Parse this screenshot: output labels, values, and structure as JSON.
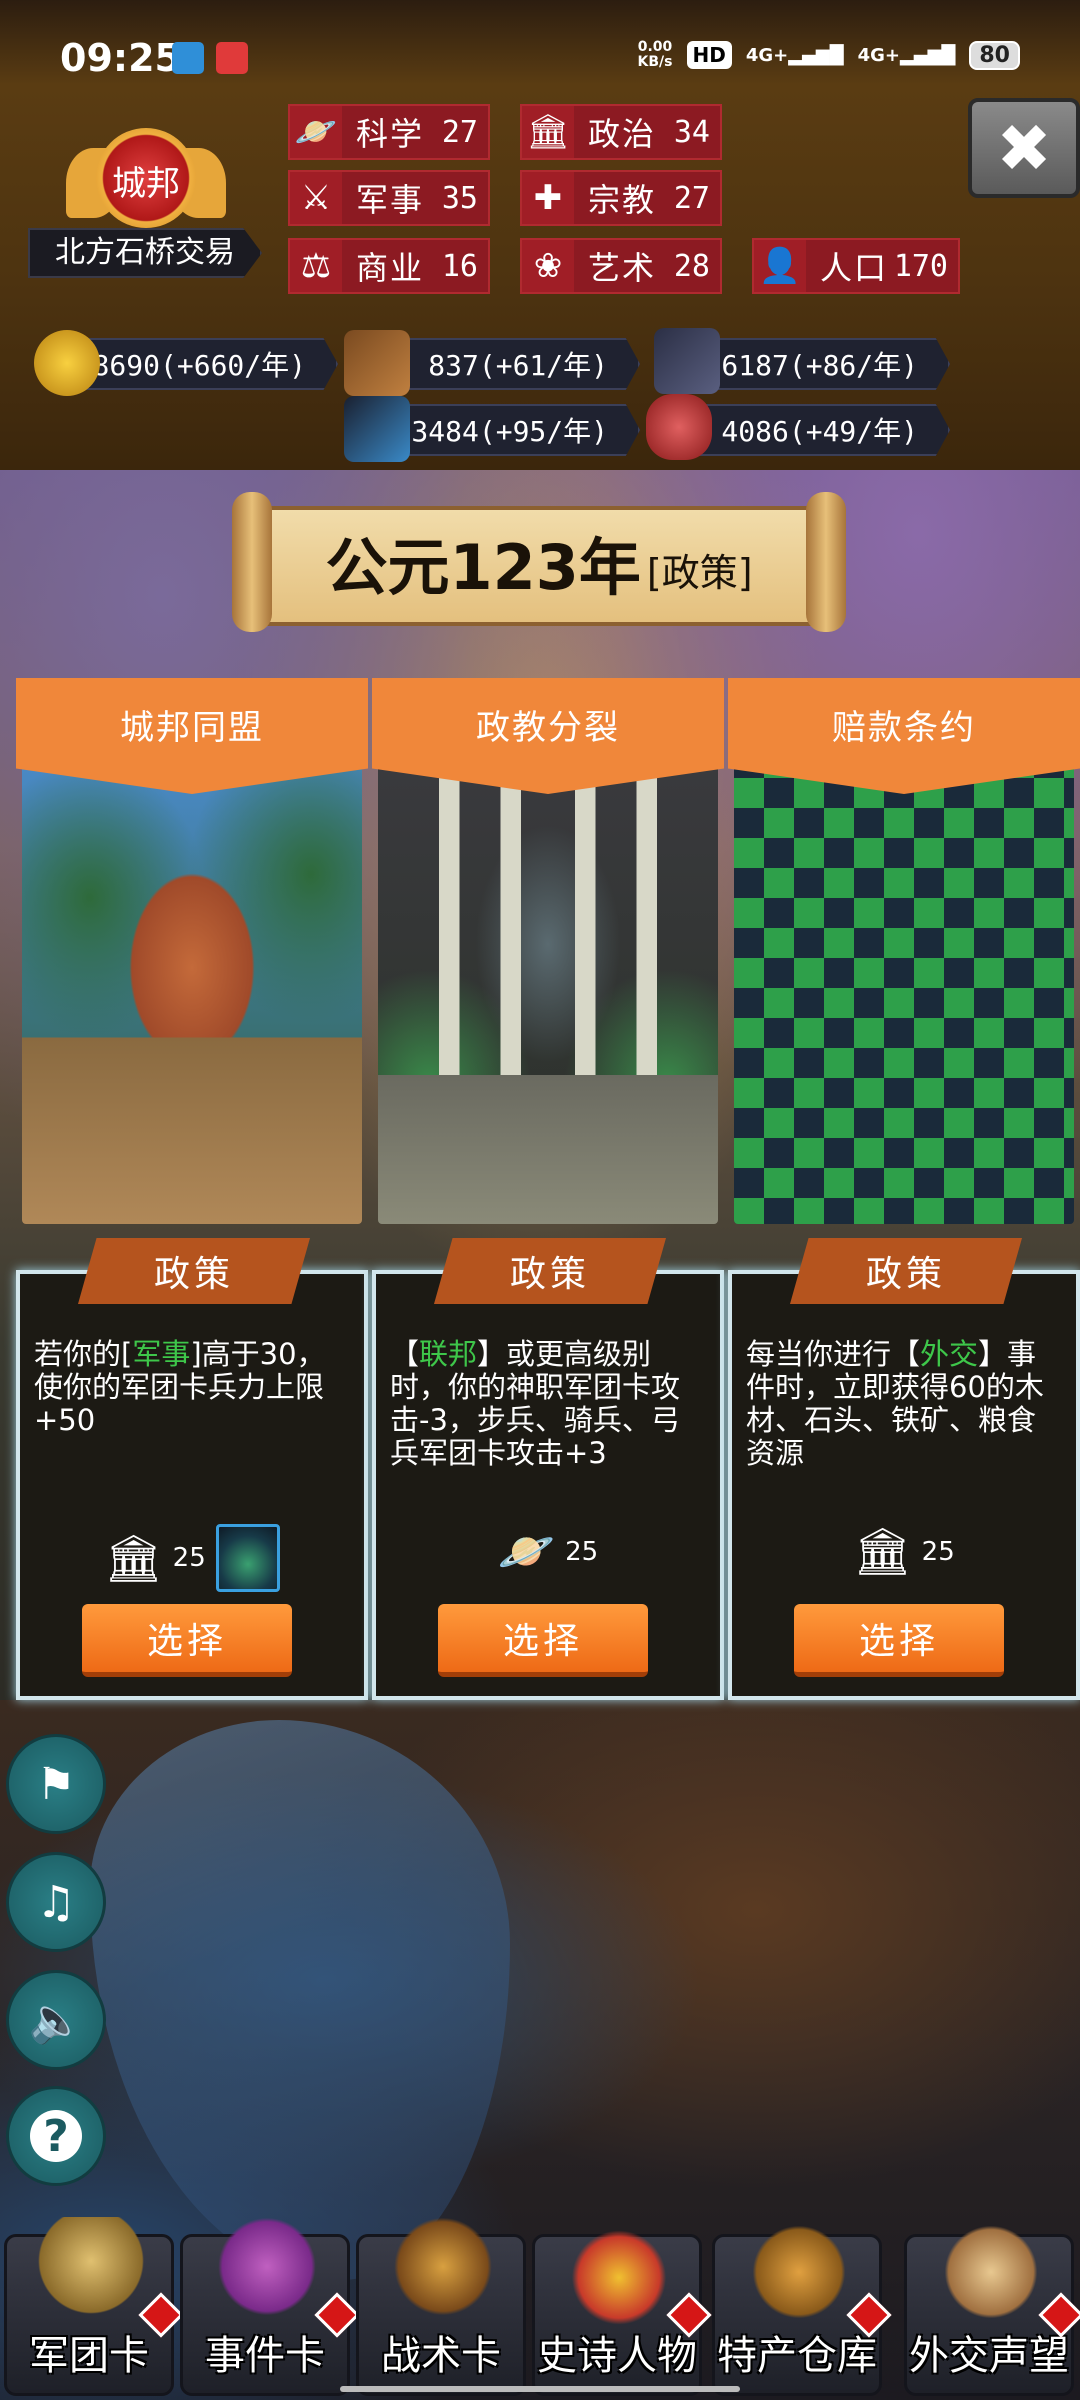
{
  "status_bar": {
    "time": "09:25",
    "net_speed": "0.00",
    "net_unit": "KB/s",
    "hd": "HD",
    "sim1": "4G+",
    "sim2": "4G+",
    "battery": "80"
  },
  "header": {
    "emblem_label": "城邦",
    "city_name": "北方石桥交易",
    "stats": [
      {
        "icon": "planet-icon",
        "name": "科学",
        "value": "27"
      },
      {
        "icon": "temple-icon",
        "name": "政治",
        "value": "34"
      },
      {
        "icon": "crossed-swords-icon",
        "name": "军事",
        "value": "35"
      },
      {
        "icon": "holy-cross-icon",
        "name": "宗教",
        "value": "27"
      },
      {
        "icon": "scales-icon",
        "name": "商业",
        "value": "16"
      },
      {
        "icon": "lotus-icon",
        "name": "艺术",
        "value": "28"
      },
      {
        "icon": "person-icon",
        "name": "人口",
        "value": "170"
      }
    ],
    "resources": [
      {
        "icon": "gold-coins-icon",
        "text": "98690(+660/年)"
      },
      {
        "icon": "wood-logs-icon",
        "text": "837(+61/年)"
      },
      {
        "icon": "stone-icon",
        "text": "6187(+86/年)"
      },
      {
        "icon": "iron-ore-icon",
        "text": "3484(+95/年)"
      },
      {
        "icon": "meat-icon",
        "text": "4086(+49/年)"
      }
    ]
  },
  "banner": {
    "year": "公元123年",
    "tag": "[政策]"
  },
  "cards": [
    {
      "title": "城邦同盟",
      "tab": "政策",
      "desc_pre": "若你的[",
      "desc_hl": "军事",
      "desc_post": "]高于30，使你的军团卡兵力上限+50",
      "cost_icon": "temple-icon",
      "cost": "25",
      "select": "选择"
    },
    {
      "title": "政教分裂",
      "tab": "政策",
      "desc_pre": "【",
      "desc_hl": "联邦",
      "desc_post": "】或更高级别时，你的神职军团卡攻击-3，步兵、骑兵、弓兵军团卡攻击+3",
      "cost_icon": "planet-icon",
      "cost": "25",
      "select": "选择"
    },
    {
      "title": "赔款条约",
      "tab": "政策",
      "desc_pre": "每当你进行【",
      "desc_hl": "外交",
      "desc_post": "】事件时，立即获得60的木材、石头、铁矿、粮食资源",
      "cost_icon": "temple-icon",
      "cost": "25",
      "select": "选择"
    }
  ],
  "side_buttons": [
    "flag-icon",
    "music-off-icon",
    "sound-icon",
    "help-icon"
  ],
  "side_help_glyph": "?",
  "nav": [
    {
      "label": "军团卡",
      "icon": "helmet-icon"
    },
    {
      "label": "事件卡",
      "icon": "scroll-icon"
    },
    {
      "label": "战术卡",
      "icon": "shield-icon"
    },
    {
      "label": "史诗人物",
      "icon": "crown-icon"
    },
    {
      "label": "特产仓库",
      "icon": "chest-icon"
    },
    {
      "label": "外交声望",
      "icon": "envelope-icon"
    }
  ],
  "colors": {
    "accent_orange": "#f0873a",
    "stat_red": "#8c1a22",
    "highlight_green": "#3ec74a"
  }
}
